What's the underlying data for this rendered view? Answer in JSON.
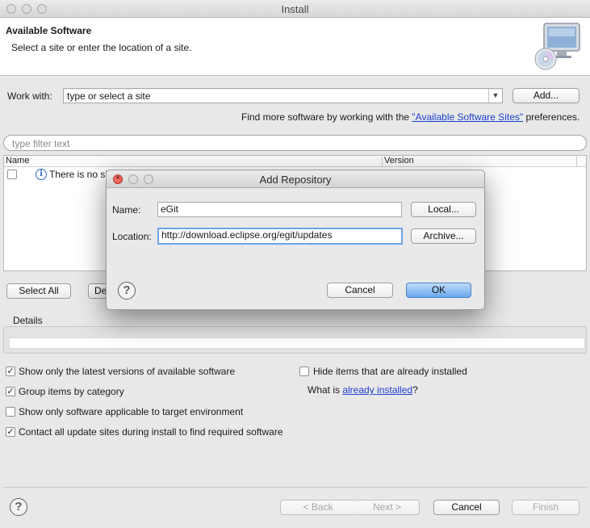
{
  "window": {
    "title": "Install"
  },
  "header": {
    "title": "Available Software",
    "description": "Select a site or enter the location of a site."
  },
  "work_with": {
    "label": "Work with:",
    "value": "type or select a site",
    "add_button": "Add...",
    "find_prefix": "Find more software by working with the ",
    "find_link": "\"Available Software Sites\"",
    "find_suffix": " preferences."
  },
  "filter": {
    "placeholder": "type filter text"
  },
  "table": {
    "columns": [
      "Name",
      "Version"
    ],
    "rows": [
      {
        "name": "There is no si",
        "checked": false
      }
    ]
  },
  "buttons": {
    "select_all": "Select All",
    "deselect_all_partial": "De"
  },
  "details": {
    "label": "Details"
  },
  "options": {
    "show_latest": {
      "label": "Show only the latest versions of available software",
      "checked": true
    },
    "group_items": {
      "label": "Group items by category",
      "checked": true
    },
    "show_applicable": {
      "label": "Show only software applicable to target environment",
      "checked": false
    },
    "contact_sites": {
      "label": "Contact all update sites during install to find required software",
      "checked": true
    },
    "hide_installed": {
      "label": "Hide items that are already installed",
      "checked": false
    },
    "what_is_prefix": "What is ",
    "what_is_link": "already installed",
    "what_is_suffix": "?"
  },
  "footer": {
    "back": "< Back",
    "next": "Next >",
    "cancel": "Cancel",
    "finish": "Finish"
  },
  "dialog": {
    "title": "Add Repository",
    "name_label": "Name:",
    "name_value": "eGit",
    "location_label": "Location:",
    "location_value": "http://download.eclipse.org/egit/updates",
    "local_button": "Local...",
    "archive_button": "Archive...",
    "cancel_button": "Cancel",
    "ok_button": "OK"
  },
  "colors": {
    "link": "#1d3fcf",
    "default_button": "#6aa8ef",
    "close_button": "#e0443a"
  },
  "icons": [
    "help-icon",
    "info-icon",
    "cd-monitor-icon",
    "dropdown-arrow-icon",
    "checkbox-icon"
  ]
}
